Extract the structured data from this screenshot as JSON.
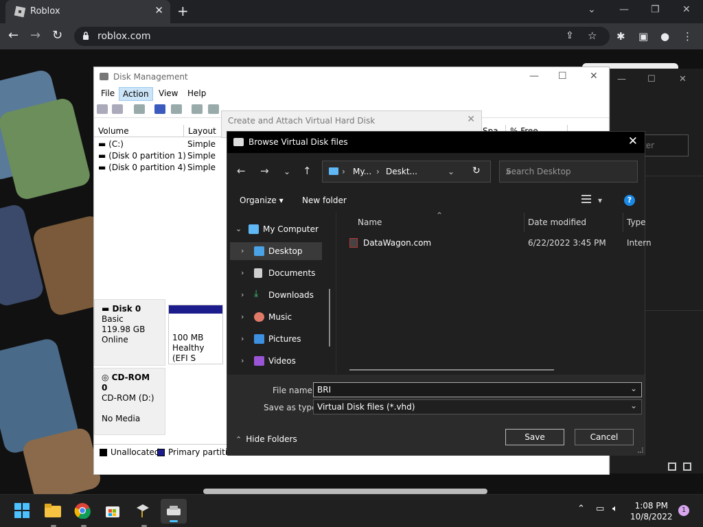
{
  "browser": {
    "tab_title": "Roblox",
    "url": "roblox.com",
    "accent": "#35363a"
  },
  "right_window": {
    "field_hint": "ter"
  },
  "disk_management": {
    "title": "Disk Management",
    "menu": [
      "File",
      "Action",
      "View",
      "Help"
    ],
    "columns": [
      "Volume",
      "Layout",
      "Spa",
      "% Free"
    ],
    "volumes": [
      {
        "volume": "(C:)",
        "layout": "Simple"
      },
      {
        "volume": "(Disk 0 partition 1)",
        "layout": "Simple"
      },
      {
        "volume": "(Disk 0 partition 4)",
        "layout": "Simple"
      }
    ],
    "disk0": {
      "name": "Disk 0",
      "type": "Basic",
      "size": "119.98 GB",
      "status": "Online"
    },
    "partition": {
      "size": "100 MB",
      "status": "Healthy (EFI S"
    },
    "cdrom": {
      "name": "CD-ROM 0",
      "drive": "CD-ROM (D:)",
      "media": "No Media"
    },
    "legend": [
      {
        "label": "Unallocated",
        "color": "#000000"
      },
      {
        "label": "Primary partition",
        "color": "#1c1c8c"
      }
    ]
  },
  "create_attach": {
    "title": "Create and Attach Virtual Hard Disk"
  },
  "browse": {
    "title": "Browse Virtual Disk files",
    "path": [
      "My...",
      "Deskt..."
    ],
    "search_placeholder": "Search Desktop",
    "organize": "Organize",
    "new_folder": "New folder",
    "help_glyph": "?",
    "tree": [
      {
        "label": "My Computer",
        "icon": "computer-icon",
        "expanded": true
      },
      {
        "label": "Desktop",
        "icon": "desktop-icon",
        "selected": true
      },
      {
        "label": "Documents",
        "icon": "documents-icon"
      },
      {
        "label": "Downloads",
        "icon": "downloads-icon"
      },
      {
        "label": "Music",
        "icon": "music-icon"
      },
      {
        "label": "Pictures",
        "icon": "pictures-icon"
      },
      {
        "label": "Videos",
        "icon": "videos-icon"
      }
    ],
    "columns": [
      "Name",
      "Date modified",
      "Type"
    ],
    "files": [
      {
        "name": "DataWagon.com",
        "date": "6/22/2022 3:45 PM",
        "type": "Intern"
      }
    ],
    "file_name_label": "File name:",
    "file_name_value": "BRI",
    "save_type_label": "Save as type:",
    "save_type_value": "Virtual Disk files (*.vhd)",
    "hide_folders": "Hide Folders",
    "save": "Save",
    "cancel": "Cancel"
  },
  "taskbar": {
    "time": "1:08 PM",
    "date": "10/8/2022",
    "notification_count": "1"
  }
}
